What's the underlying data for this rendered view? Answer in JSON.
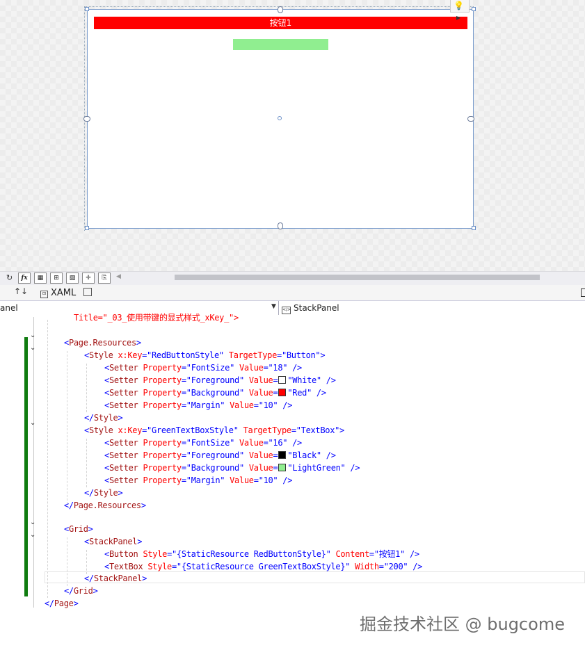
{
  "designer": {
    "button_content": "按钮1",
    "colors": {
      "button_bg": "#ff0000",
      "button_fg": "#ffffff",
      "textbox_bg": "#90ee90"
    }
  },
  "toolbar": {
    "fx_label": "fx",
    "buttons": [
      "grid-icon",
      "snap-grid-icon",
      "toggle-artboard-icon",
      "snap-lines-icon",
      "code-icon"
    ]
  },
  "tabs": {
    "swap_label": "↑↓",
    "xaml_label": "XAML"
  },
  "navbar": {
    "left_value": "anel",
    "right_value": "StackPanel"
  },
  "code": {
    "title_line": "Title=\"_03_使用带键的显式样式_xKey_\">",
    "watermark": "掘金技术社区 @ bugcome"
  }
}
